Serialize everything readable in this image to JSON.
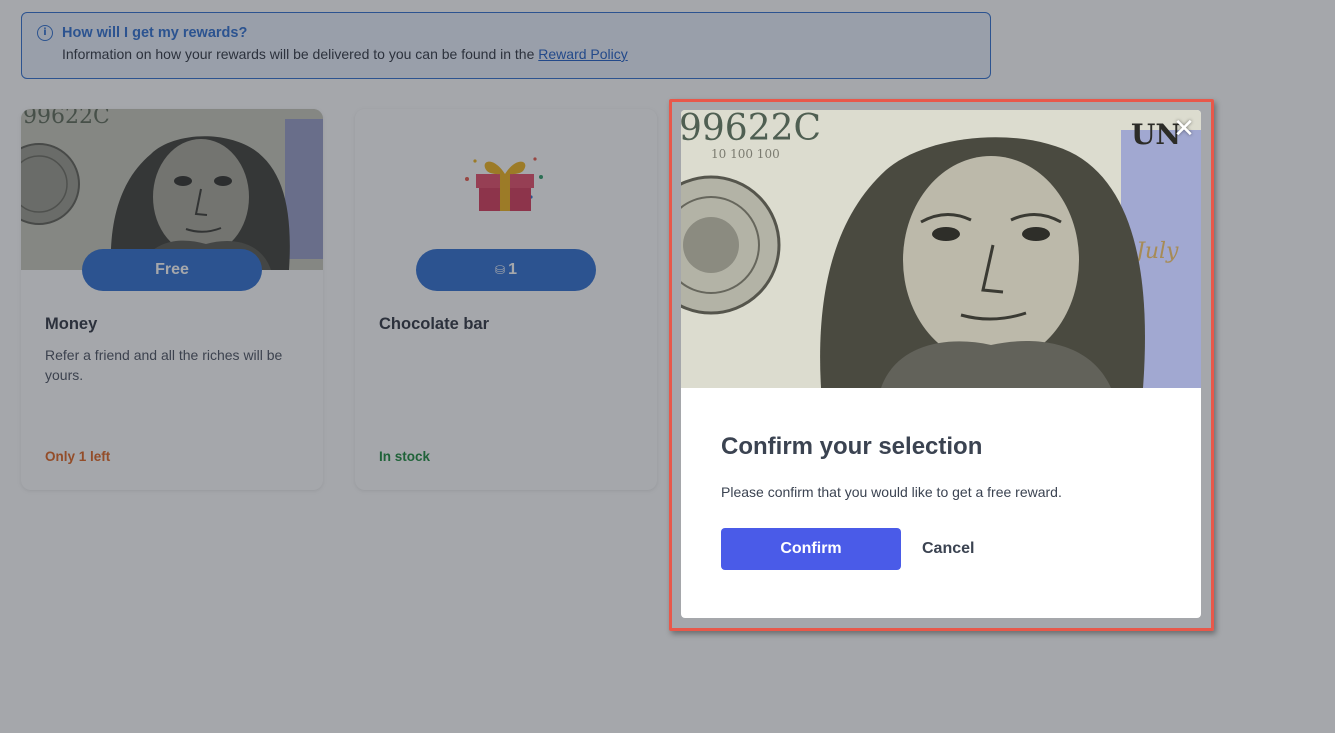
{
  "info": {
    "title": "How will I get my rewards?",
    "text": "Information on how your rewards will be delivered to you can be found in the ",
    "link": "Reward Policy"
  },
  "rewards": [
    {
      "price": "Free",
      "name": "Money",
      "description": "Refer a friend and all the riches will be yours.",
      "stock": "Only 1 left",
      "stock_color": "#e0641f"
    },
    {
      "price": "1",
      "name": "Chocolate bar",
      "description": "",
      "stock": "In stock",
      "stock_color": "#1a8a3c"
    }
  ],
  "modal": {
    "title": "Confirm your selection",
    "text": "Please confirm that you would like to get a free reward.",
    "confirm_label": "Confirm",
    "cancel_label": "Cancel"
  },
  "colors": {
    "accent": "#2f6fd0",
    "confirm": "#4a5be8",
    "highlight": "#e8584a"
  }
}
